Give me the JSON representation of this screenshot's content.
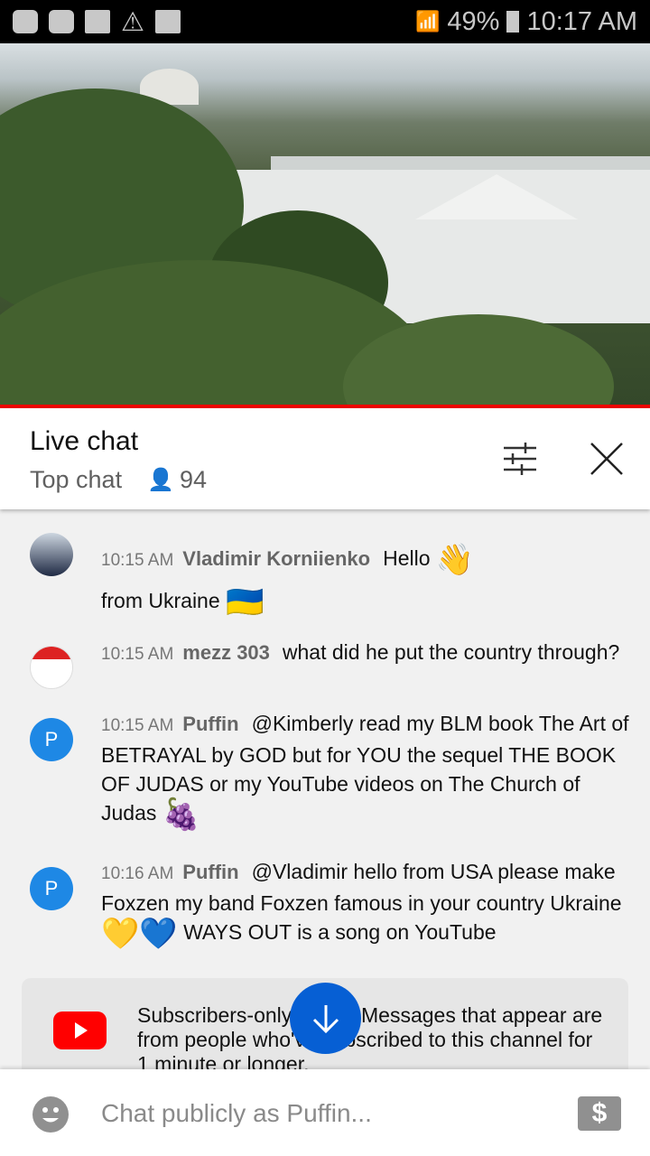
{
  "status_bar": {
    "battery": "49%",
    "time": "10:17 AM",
    "left_icons": [
      "app-icon",
      "youtube-icon",
      "folder-icon",
      "warning-icon",
      "image-icon"
    ],
    "right_icons": [
      "wifi-icon",
      "signal-icon",
      "battery-icon"
    ]
  },
  "header": {
    "title": "Live chat",
    "mode": "Top chat",
    "viewers": "94"
  },
  "messages": [
    {
      "time": "10:15 AM",
      "author": "Vladimir Korniienko",
      "text": "Hello",
      "emoji1": "👋",
      "text2": "from Ukraine",
      "emoji2": "🇺🇦"
    },
    {
      "time": "10:15 AM",
      "author": "mezz 303",
      "text": "what did he put the country through?"
    },
    {
      "time": "10:15 AM",
      "author": "Puffin",
      "avatar": "P",
      "text": "@Kimberly read my BLM book The Art of BETRAYAL by GOD but for YOU the sequel THE BOOK OF JUDAS or my YouTube videos on The Church of Judas",
      "emoji1": "🍇"
    },
    {
      "time": "10:16 AM",
      "author": "Puffin",
      "avatar": "P",
      "text": "@Vladimir hello from USA please make Foxzen my band Foxzen famous in your country Ukraine",
      "emoji1": "💛💙",
      "text2": "WAYS OUT is a song on YouTube"
    }
  ],
  "banner": {
    "text": "Subscribers-only mode. Messages that appear are from people who've subscribed to this channel for 1 minute or longer."
  },
  "input": {
    "placeholder": "Chat publicly as Puffin...",
    "dollar": "$"
  },
  "colors": {
    "accent": "#065fd4",
    "progress": "#ee0000",
    "youtube": "#ff0000"
  }
}
